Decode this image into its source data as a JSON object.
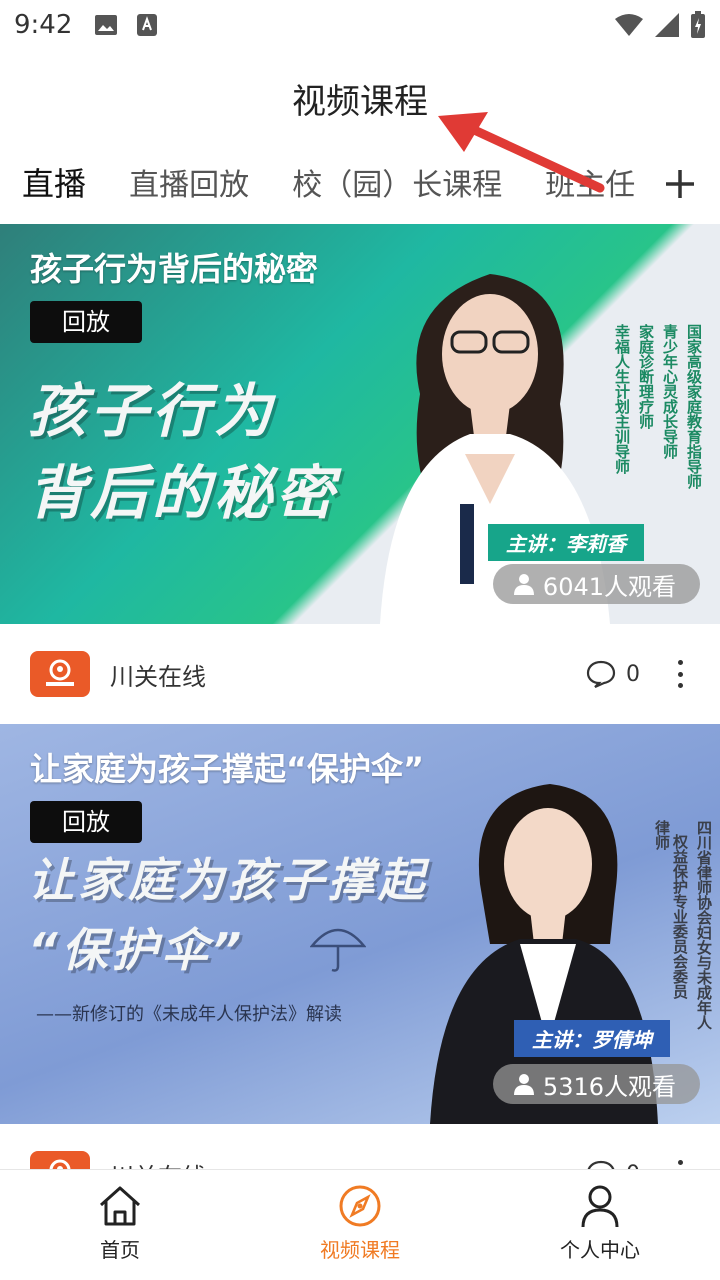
{
  "status_bar": {
    "time": "9:42"
  },
  "page_title": "视频课程",
  "tabs": [
    {
      "label": "直播",
      "active": true
    },
    {
      "label": "直播回放",
      "active": false
    },
    {
      "label": "校（园）长课程",
      "active": false
    },
    {
      "label": "班主任",
      "active": false
    }
  ],
  "cards": [
    {
      "banner_title": "孩子行为背后的秘密",
      "tag": "回放",
      "big_text_line1": "孩子行为",
      "big_text_line2": "背后的秘密",
      "speaker": "主讲：李莉香",
      "credentials": [
        "国家高级家庭教育指导师",
        "青少年心灵成长导师",
        "家庭诊断理疗师",
        "幸福人生计划主训导师"
      ],
      "viewers": "6041人观看",
      "channel": "川关在线",
      "comments": "0"
    },
    {
      "banner_title": "让家庭为孩子撑起“保护伞”",
      "tag": "回放",
      "big_text_line1": "让家庭为孩子撑起",
      "big_text_line2": "“保护伞”",
      "subtitle": "——新修订的《未成年人保护法》解读",
      "speaker": "主讲：罗倩坤",
      "credentials": [
        "四川省律师协会妇女与未成年人",
        "权益保护专业委员会委员",
        "律师"
      ],
      "viewers": "5316人观看",
      "channel": "川关在线",
      "comments": "0"
    }
  ],
  "bottom_nav": [
    {
      "label": "首页",
      "icon": "home-icon",
      "active": false
    },
    {
      "label": "视频课程",
      "icon": "compass-icon",
      "active": true
    },
    {
      "label": "个人中心",
      "icon": "person-icon",
      "active": false
    }
  ],
  "colors": {
    "accent": "#f07b24",
    "arrow": "#e03a35",
    "logo": "#ea5a28"
  }
}
